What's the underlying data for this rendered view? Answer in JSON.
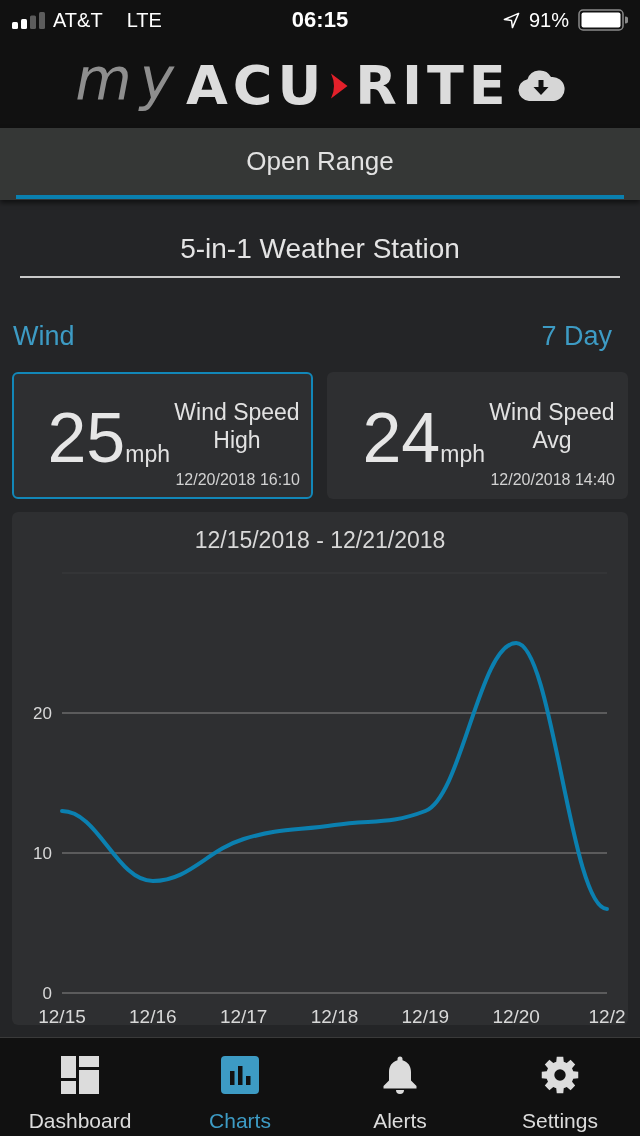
{
  "status_bar": {
    "carrier": "AT&T",
    "network": "LTE",
    "time": "06:15",
    "battery": "91%"
  },
  "header": {
    "logo": {
      "prefix": "my",
      "first": "ACU",
      "second": "RITE"
    }
  },
  "tabs": [
    {
      "label": "Open Range",
      "selected": true
    }
  ],
  "station": {
    "title": "5-in-1 Weather Station"
  },
  "sensor": {
    "label": "Wind",
    "period": "7 Day"
  },
  "readings": [
    {
      "speed": "25",
      "unit": "mph",
      "title": "Wind Speed High",
      "timestamp": "12/20/2018 16:10",
      "selected": true
    },
    {
      "speed": "24",
      "unit": "mph",
      "title": "Wind Speed Avg",
      "timestamp": "12/20/2018 14:40",
      "selected": false
    }
  ],
  "chart": {
    "title": "12/15/2018 - 12/21/2018",
    "chart_data": {
      "type": "line",
      "categories": [
        "12/15",
        "12/16",
        "12/17",
        "12/18",
        "12/19",
        "12/20",
        "12/2"
      ],
      "values": [
        13,
        8,
        11,
        12,
        13,
        25,
        6
      ],
      "ylim": [
        0,
        30
      ],
      "yticks": [
        0,
        10,
        20
      ]
    }
  },
  "nav": [
    {
      "label": "Dashboard",
      "selected": false
    },
    {
      "label": "Charts",
      "selected": true
    },
    {
      "label": "Alerts",
      "selected": false
    },
    {
      "label": "Settings",
      "selected": false
    }
  ]
}
